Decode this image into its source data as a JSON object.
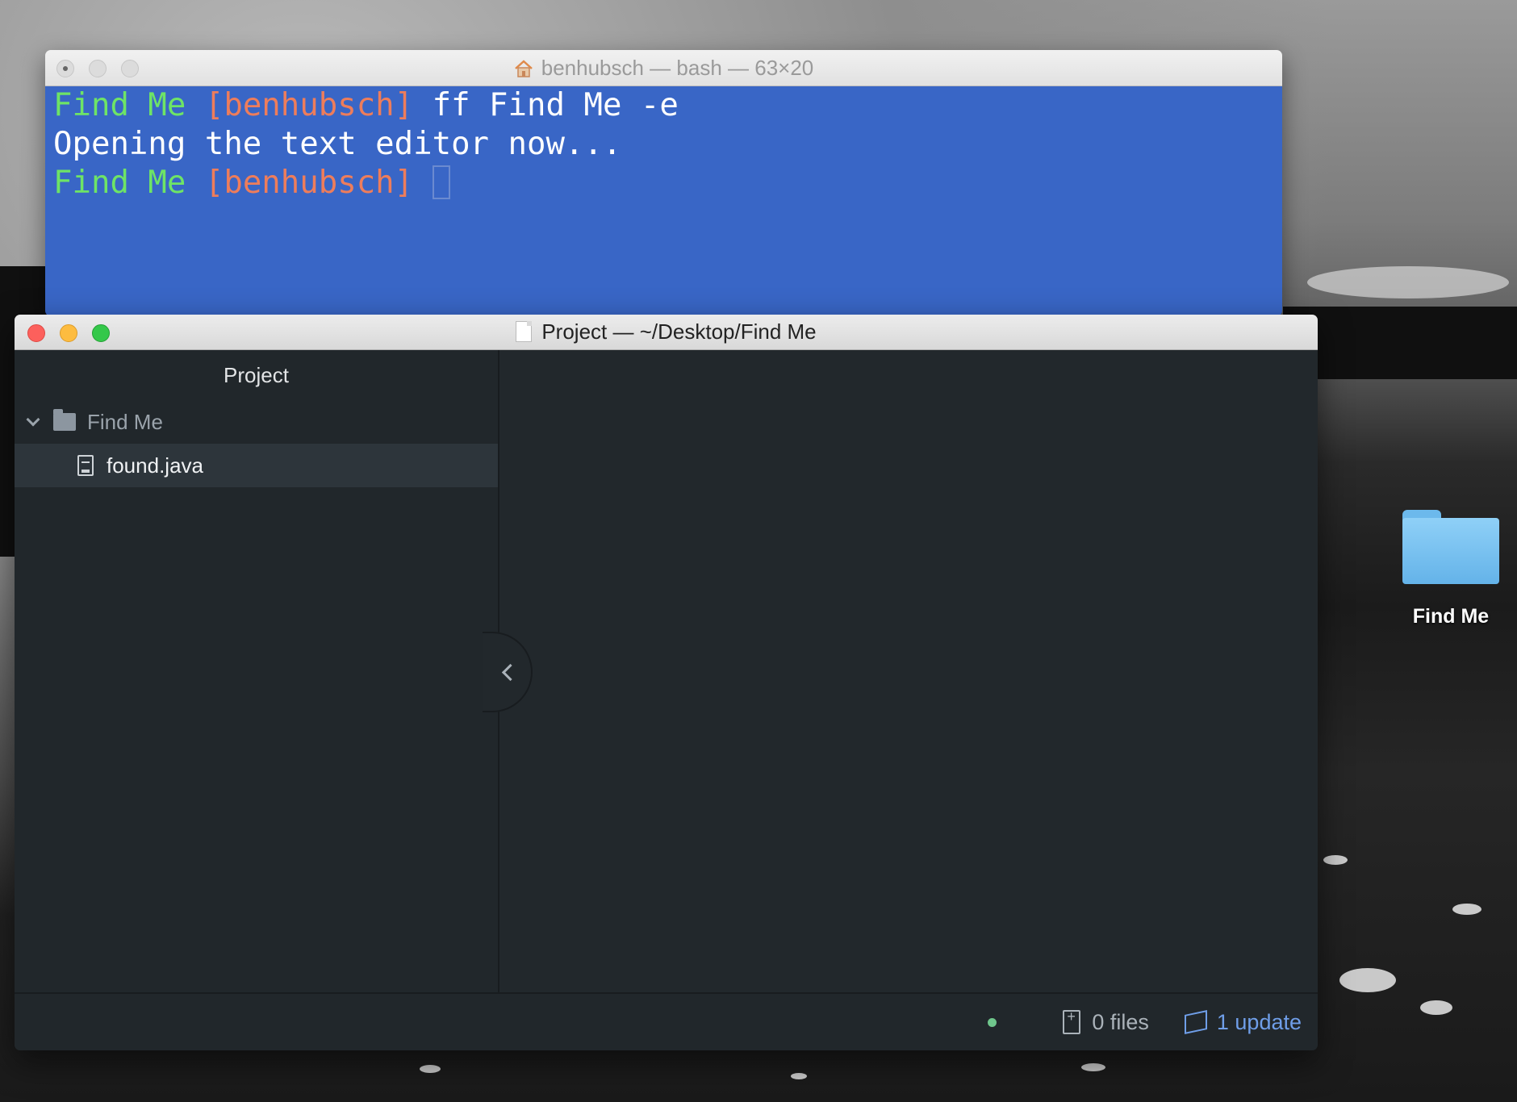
{
  "terminal": {
    "title": "benhubsch — bash — 63×20",
    "lines": [
      {
        "prompt_dir": "Find Me",
        "prompt_user": "[benhubsch]",
        "command": " ff Find Me -e"
      },
      {
        "output": "Opening the text editor now..."
      },
      {
        "prompt_dir": "Find Me",
        "prompt_user": "[benhubsch]"
      }
    ]
  },
  "editor": {
    "title": "Project — ~/Desktop/Find Me",
    "panel_title": "Project",
    "tree": {
      "folder": "Find Me",
      "files": [
        "found.java"
      ]
    },
    "statusbar": {
      "files": "0 files",
      "updates": "1 update"
    }
  },
  "desktop": {
    "folder_label": "Find Me"
  },
  "colors": {
    "terminal_bg": "#3966c6",
    "prompt_dir": "#6ee466",
    "prompt_user": "#ee7d5b",
    "editor_bg": "#22282c",
    "update_link": "#6f9ee8"
  }
}
